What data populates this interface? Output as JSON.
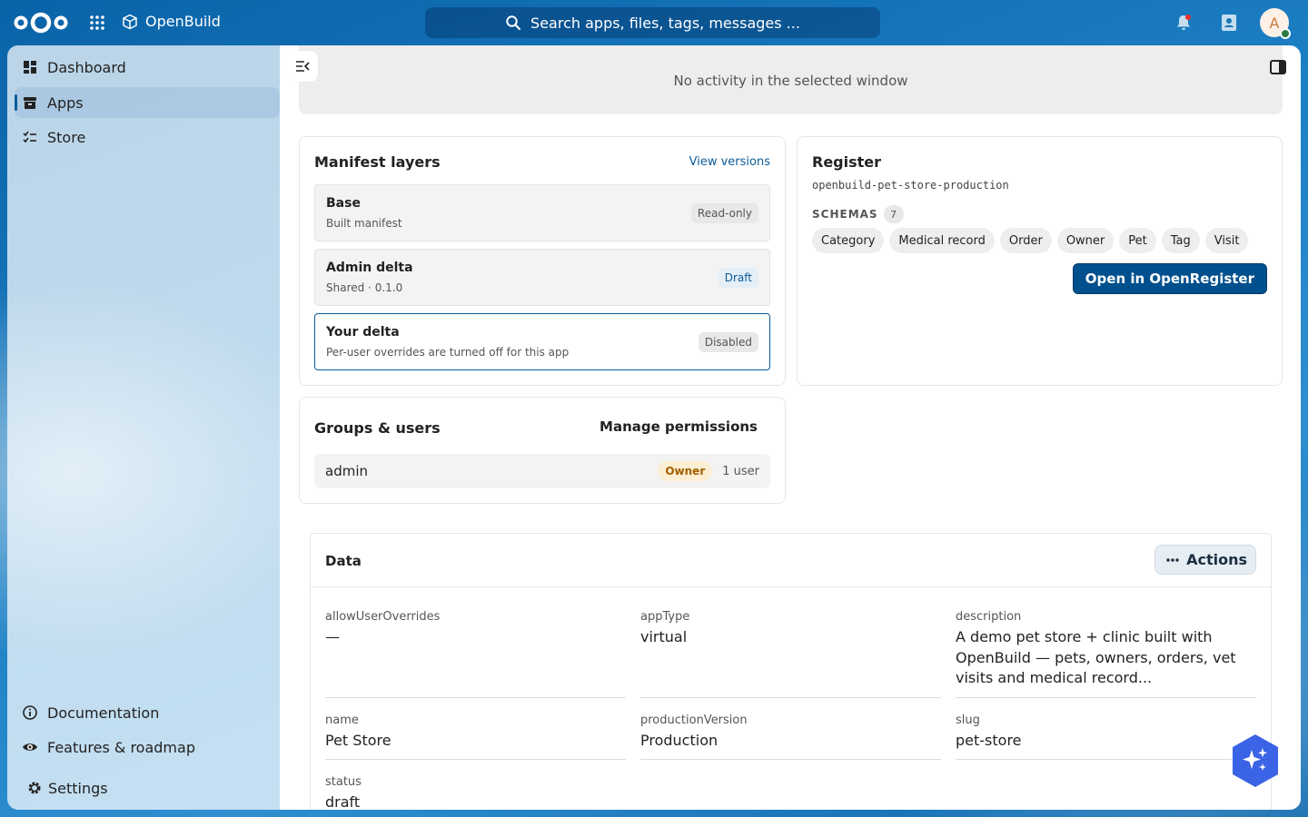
{
  "app": {
    "name": "OpenBuild"
  },
  "search": {
    "placeholder": "Search apps, files, tags, messages ..."
  },
  "user": {
    "initial": "A"
  },
  "sidebar": {
    "items": [
      {
        "label": "Dashboard",
        "icon": "dashboard-icon"
      },
      {
        "label": "Apps",
        "icon": "archive-icon",
        "active": true
      },
      {
        "label": "Store",
        "icon": "checklist-icon"
      }
    ],
    "footer": [
      {
        "label": "Documentation",
        "icon": "info-icon"
      },
      {
        "label": "Features & roadmap",
        "icon": "eye-icon"
      },
      {
        "label": "Settings",
        "icon": "gear-icon"
      }
    ]
  },
  "activity": {
    "empty_text": "No activity in the selected window"
  },
  "manifest": {
    "title": "Manifest layers",
    "view_versions": "View versions",
    "layers": [
      {
        "name": "Base",
        "sub": "Built manifest",
        "status": "Read-only"
      },
      {
        "name": "Admin delta",
        "sub": "Shared · 0.1.0",
        "status": "Draft"
      },
      {
        "name": "Your delta",
        "sub": "Per-user overrides are turned off for this app",
        "status": "Disabled"
      }
    ]
  },
  "register": {
    "title": "Register",
    "slug": "openbuild-pet-store-production",
    "schemas_label": "SCHEMAS",
    "schemas_count": "7",
    "schemas": [
      "Category",
      "Medical record",
      "Order",
      "Owner",
      "Pet",
      "Tag",
      "Visit"
    ],
    "open_button": "Open in OpenRegister"
  },
  "groups": {
    "title": "Groups & users",
    "manage": "Manage permissions",
    "rows": [
      {
        "name": "admin",
        "role": "Owner",
        "count": "1 user"
      }
    ]
  },
  "data": {
    "title": "Data",
    "actions": "Actions",
    "fields": [
      {
        "label": "allowUserOverrides",
        "value": "—"
      },
      {
        "label": "appType",
        "value": "virtual"
      },
      {
        "label": "description",
        "value": "A demo pet store + clinic built with OpenBuild — pets, owners, orders, vet visits and medical record..."
      },
      {
        "label": "name",
        "value": "Pet Store"
      },
      {
        "label": "productionVersion",
        "value": "Production"
      },
      {
        "label": "slug",
        "value": "pet-store"
      },
      {
        "label": "status",
        "value": "draft"
      }
    ]
  },
  "colors": {
    "header": "#0b6bb0",
    "primary": "#00508e",
    "notification": "#e9322d",
    "online": "#2d7b41"
  }
}
